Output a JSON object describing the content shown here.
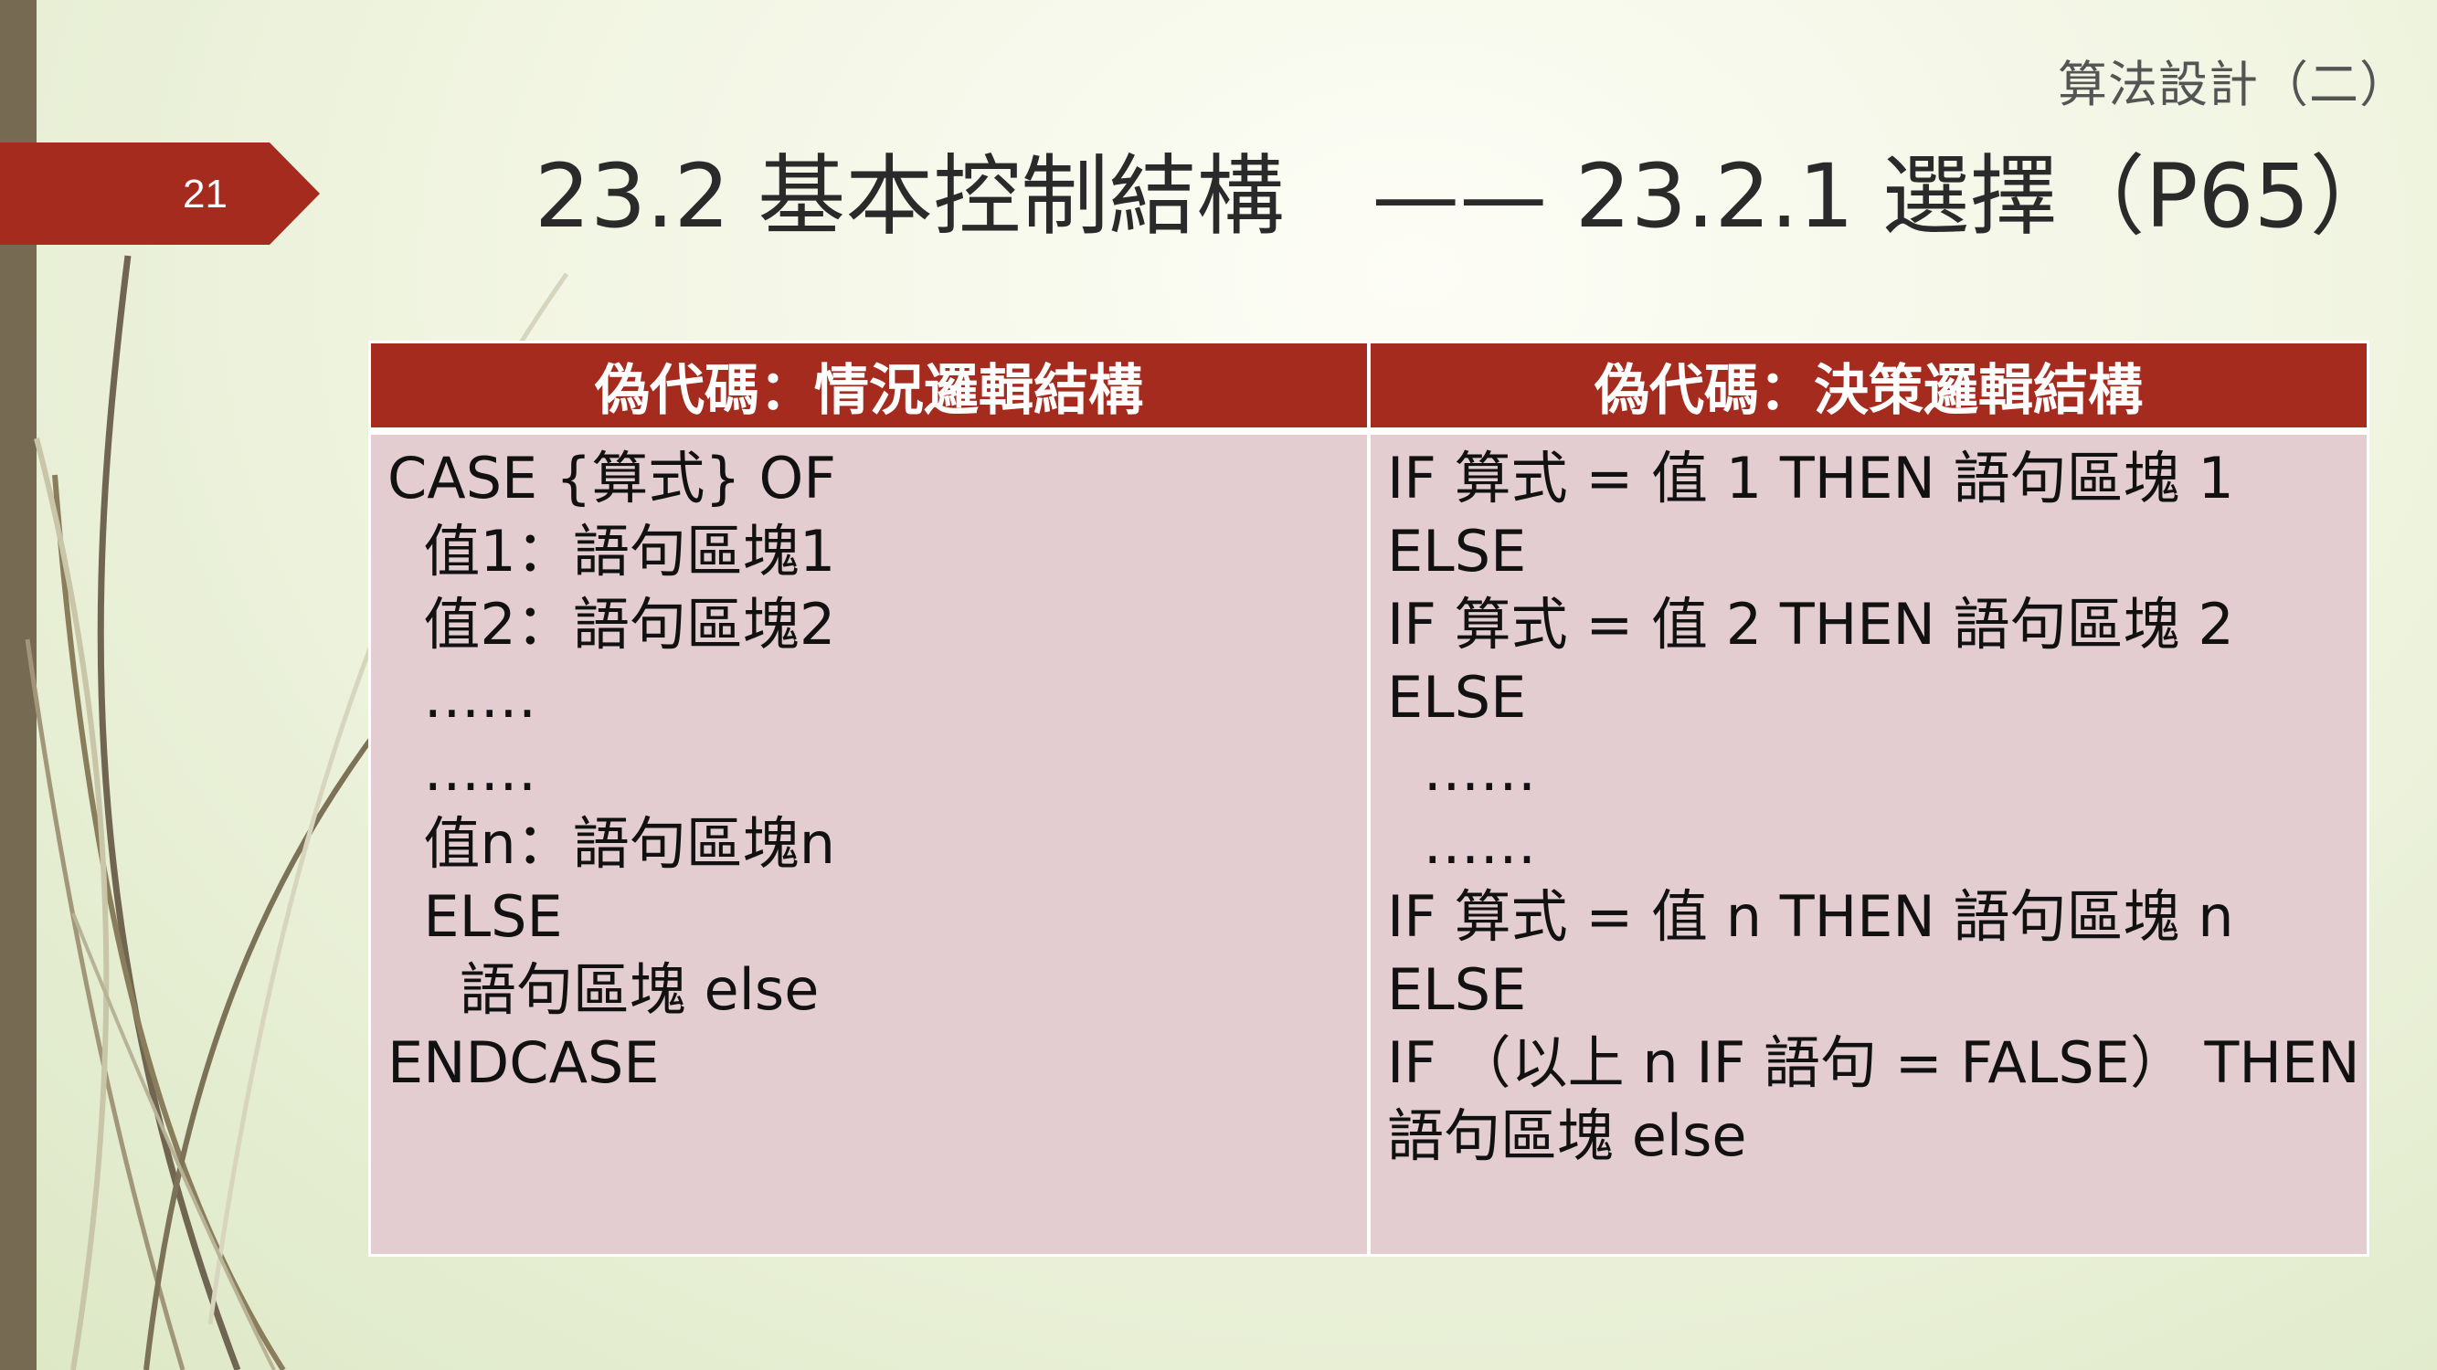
{
  "slide": {
    "number": "21",
    "header_label": "算法設計（二）",
    "title": "23.2 基本控制結構　—— 23.2.1 選擇（P65）"
  },
  "table": {
    "headers": [
      "偽代碼：情況邏輯結構",
      "偽代碼：決策邏輯結構"
    ],
    "left_lines": [
      "CASE {算式} OF",
      "  值1：語句區塊1",
      "  值2：語句區塊2",
      "  ……",
      "  ……",
      "  值n：語句區塊n",
      "  ELSE",
      "    語句區塊 else",
      "ENDCASE"
    ],
    "right_lines": [
      "IF 算式 = 值 1 THEN 語句區塊 1",
      "ELSE",
      "IF 算式 = 值 2 THEN 語句區塊 2",
      "ELSE",
      "  ……",
      "  ……",
      "IF 算式 = 值 n THEN 語句區塊 n",
      "ELSE",
      "IF （以上 n IF 語句 = FALSE） THEN",
      "語句區塊 else"
    ]
  },
  "colors": {
    "accent": "#a52b1e",
    "cell_background": "#e3cdd0",
    "left_bar": "#766b52"
  }
}
